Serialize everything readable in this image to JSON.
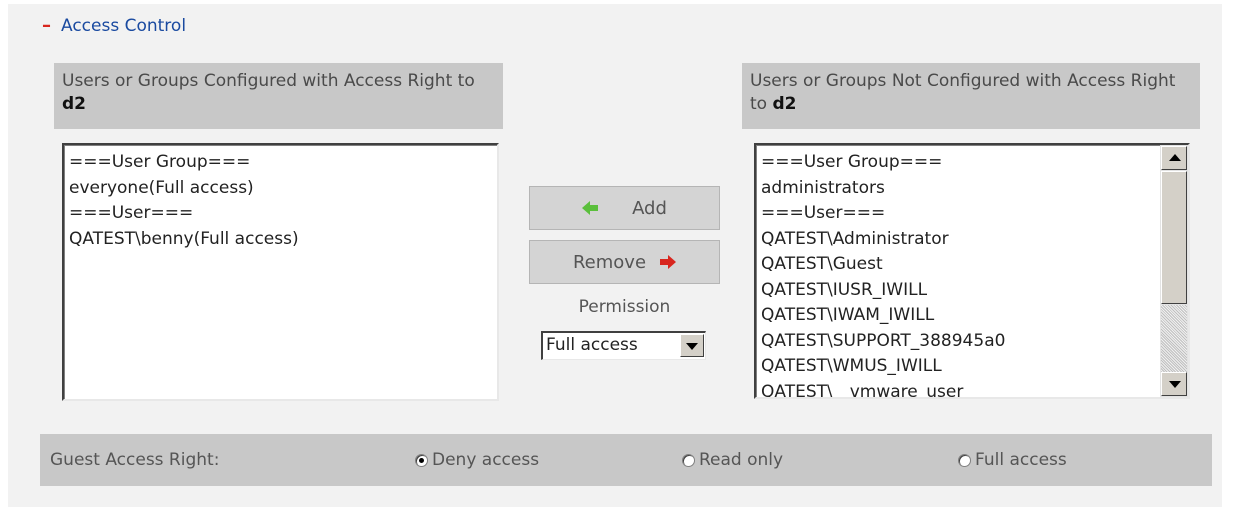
{
  "section": {
    "collapse_symbol": "–",
    "title": "Access Control"
  },
  "configured_panel": {
    "title_prefix": "Users or Groups Configured with Access Right to",
    "share_name": "d2",
    "items": [
      "===User Group===",
      "everyone(Full access)",
      "===User===",
      "QATEST\\benny(Full access)"
    ]
  },
  "not_configured_panel": {
    "title_prefix": "Users or Groups Not Configured with Access Right to",
    "share_name": "d2",
    "items": [
      "===User Group===",
      "administrators",
      "===User===",
      "QATEST\\Administrator",
      "QATEST\\Guest",
      "QATEST\\IUSR_IWILL",
      "QATEST\\IWAM_IWILL",
      "QATEST\\SUPPORT_388945a0",
      "QATEST\\WMUS_IWILL",
      "QATEST\\__vmware_user__"
    ]
  },
  "actions": {
    "add_label": "Add",
    "remove_label": "Remove"
  },
  "permission": {
    "label": "Permission",
    "selected": "Full access"
  },
  "guest_access": {
    "label": "Guest Access Right:",
    "options": [
      {
        "label": "Deny access",
        "checked": true
      },
      {
        "label": "Read only",
        "checked": false
      },
      {
        "label": "Full access",
        "checked": false
      }
    ]
  },
  "colors": {
    "add_arrow": "#5bbf3c",
    "remove_arrow": "#d8261e",
    "section_title": "#1a4aa0"
  }
}
